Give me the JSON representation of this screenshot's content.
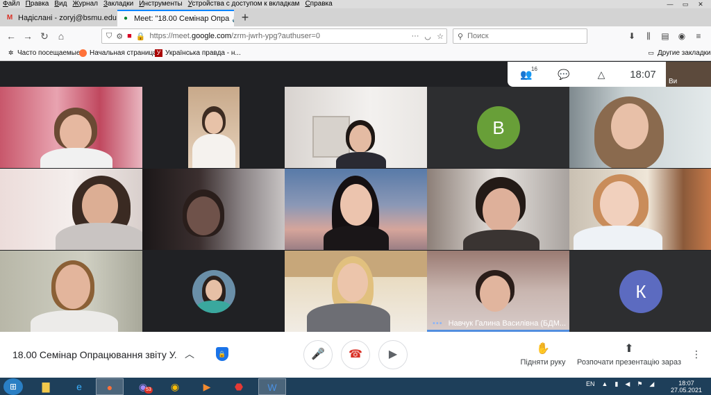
{
  "menu": [
    "Файл",
    "Правка",
    "Вид",
    "Журнал",
    "Закладки",
    "Инструменты",
    "Устройства с доступом к вкладкам",
    "Справка"
  ],
  "tabs": [
    {
      "title": "Надіслані - zoryj@bsmu.edu.u",
      "favicon": "M",
      "favicon_color": "#d93025"
    },
    {
      "title": "Meet: \"18.00 Семінар Опра",
      "favicon": "●",
      "favicon_color": "#00832d"
    }
  ],
  "url": {
    "prefix": "https://meet.",
    "host": "google.com",
    "suffix": "/zrm-jwrh-ypg?authuser=0"
  },
  "search_placeholder": "Поиск",
  "bookmarks": [
    "Часто посещаемые",
    "Начальная страница",
    "Українська правда - н...",
    "Другие закладки"
  ],
  "meet": {
    "participant_count": "16",
    "time": "18:07",
    "self_label": "Ви",
    "meeting_title": "18.00 Семінар Опрацювання звіту У...",
    "raise_hand": "Підняти руку",
    "present": "Розпочати презентацію зараз",
    "active_speaker": "Навчук Галина Василівна (БДМ...",
    "avatars": {
      "b": "В",
      "k": "К"
    },
    "colors": {
      "green_avatar": "#689f38",
      "blue_avatar": "#5c6bc0",
      "accent": "#1a73e8",
      "end_call": "#d93025"
    }
  },
  "taskbar": {
    "viber_badge": "53",
    "lang": "EN",
    "time": "18:07",
    "date": "27.05.2021"
  }
}
